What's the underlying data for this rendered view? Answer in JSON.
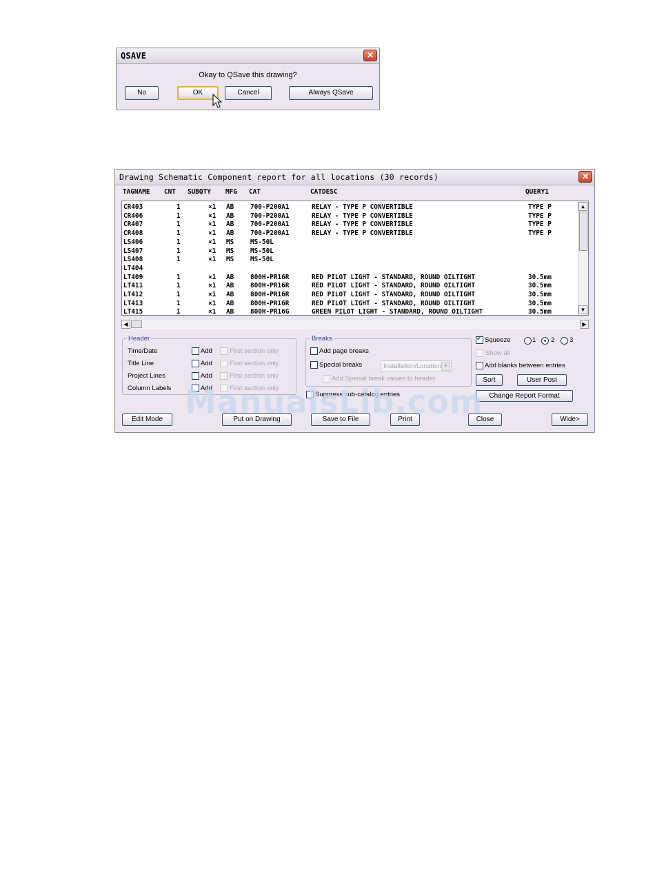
{
  "qsave_dialog": {
    "title": "QSAVE",
    "message": "Okay to QSave this drawing?",
    "buttons": {
      "no": "No",
      "ok": "OK",
      "cancel": "Cancel",
      "always": "Always QSave"
    }
  },
  "report_dialog": {
    "title": "Drawing Schematic Component report for all locations (30 records)",
    "columns": [
      "TAGNAME",
      "CNT",
      "SUBQTY",
      "MFG",
      "CAT",
      "CATDESC",
      "QUERY1"
    ],
    "rows": [
      {
        "tag": "CR403",
        "cnt": "1",
        "subqty": "×1",
        "mfg": "AB",
        "cat": "700-P200A1",
        "desc": "RELAY - TYPE P CONVERTIBLE",
        "query": "TYPE P"
      },
      {
        "tag": "CR406",
        "cnt": "1",
        "subqty": "×1",
        "mfg": "AB",
        "cat": "700-P200A1",
        "desc": "RELAY - TYPE P CONVERTIBLE",
        "query": "TYPE P"
      },
      {
        "tag": "CR407",
        "cnt": "1",
        "subqty": "×1",
        "mfg": "AB",
        "cat": "700-P200A1",
        "desc": "RELAY - TYPE P CONVERTIBLE",
        "query": "TYPE P"
      },
      {
        "tag": "CR408",
        "cnt": "1",
        "subqty": "×1",
        "mfg": "AB",
        "cat": "700-P200A1",
        "desc": "RELAY - TYPE P CONVERTIBLE",
        "query": "TYPE P"
      },
      {
        "tag": "LS406",
        "cnt": "1",
        "subqty": "×1",
        "mfg": "MS",
        "cat": "MS-50L",
        "desc": "",
        "query": ""
      },
      {
        "tag": "LS407",
        "cnt": "1",
        "subqty": "×1",
        "mfg": "MS",
        "cat": "MS-50L",
        "desc": "",
        "query": ""
      },
      {
        "tag": "LS408",
        "cnt": "1",
        "subqty": "×1",
        "mfg": "MS",
        "cat": "MS-50L",
        "desc": "",
        "query": ""
      },
      {
        "tag": "LT404",
        "cnt": "",
        "subqty": "",
        "mfg": "",
        "cat": "",
        "desc": "",
        "query": ""
      },
      {
        "tag": "LT409",
        "cnt": "1",
        "subqty": "×1",
        "mfg": "AB",
        "cat": "800H-PR16R",
        "desc": "RED PILOT LIGHT - STANDARD, ROUND OILTIGHT",
        "query": "30.5mm"
      },
      {
        "tag": "LT411",
        "cnt": "1",
        "subqty": "×1",
        "mfg": "AB",
        "cat": "800H-PR16R",
        "desc": "RED PILOT LIGHT - STANDARD, ROUND OILTIGHT",
        "query": "30.5mm"
      },
      {
        "tag": "LT412",
        "cnt": "1",
        "subqty": "×1",
        "mfg": "AB",
        "cat": "800H-PR16R",
        "desc": "RED PILOT LIGHT - STANDARD, ROUND OILTIGHT",
        "query": "30.5mm"
      },
      {
        "tag": "LT413",
        "cnt": "1",
        "subqty": "×1",
        "mfg": "AB",
        "cat": "800H-PR16R",
        "desc": "RED PILOT LIGHT - STANDARD, ROUND OILTIGHT",
        "query": "30.5mm"
      },
      {
        "tag": "LT415",
        "cnt": "1",
        "subqty": "×1",
        "mfg": "AB",
        "cat": "800H-PR16G",
        "desc": "GREEN PILOT LIGHT - STANDARD, ROUND OILTIGHT",
        "query": "30.5mm"
      }
    ],
    "header_group": {
      "label": "Header",
      "items": [
        {
          "label": "Time/Date",
          "add": "Add",
          "first": "First section only"
        },
        {
          "label": "Title Line",
          "add": "Add",
          "first": "First section only"
        },
        {
          "label": "Project Lines",
          "add": "Add",
          "first": "First section only"
        },
        {
          "label": "Column Labels",
          "add": "Add",
          "first": "First section only"
        }
      ]
    },
    "breaks_group": {
      "label": "Breaks",
      "add_page_breaks": "Add page breaks",
      "special_breaks": "Special breaks",
      "special_select": "Installation/Location",
      "add_special_values": "Add Special break values to header"
    },
    "suppress": "Suppress sub-catalog entries",
    "squeeze": {
      "label": "Squeeze",
      "options": [
        "1",
        "2",
        "3"
      ],
      "selected": "2"
    },
    "show_all": "Show all",
    "add_blanks": "Add blanks between entries",
    "sort": "Sort",
    "user_post": "User Post",
    "change_format": "Change Report Format",
    "bottom_buttons": {
      "edit_mode": "Edit Mode",
      "put_on_drawing": "Put on Drawing",
      "save_to_file": "Save to File",
      "print": "Print",
      "close": "Close",
      "wide": "Wide>"
    }
  },
  "watermark": "ManualsLib.com"
}
